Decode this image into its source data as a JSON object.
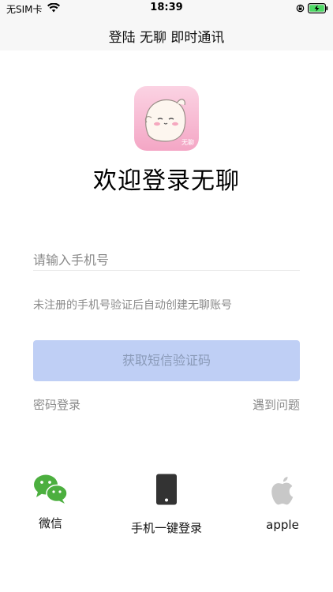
{
  "status_bar": {
    "carrier": "无SIM卡",
    "time": "18:39",
    "icons": [
      "wifi-icon",
      "rotation-lock-icon",
      "battery-charging-icon"
    ]
  },
  "nav": {
    "title": "登陆 无聊 即时通讯"
  },
  "app_icon": {
    "label": "无聊",
    "colors": {
      "top": "#fbd3e3",
      "bottom": "#f4a6c5"
    }
  },
  "welcome": "欢迎登录无聊",
  "phone_input": {
    "placeholder": "请输入手机号",
    "value": ""
  },
  "hint": "未注册的手机号验证后自动创建无聊账号",
  "sms_button": {
    "label": "获取短信验证码",
    "background": "#bfcff5"
  },
  "links": {
    "password_login": "密码登录",
    "problem": "遇到问题"
  },
  "third_party": {
    "wechat": {
      "label": "微信",
      "icon": "wechat-icon",
      "color": "#4caf3f"
    },
    "phone": {
      "label": "手机一键登录",
      "icon": "mobile-phone-icon",
      "color": "#333333"
    },
    "apple": {
      "label": "apple",
      "icon": "apple-icon",
      "color": "#c8c8c8"
    }
  }
}
